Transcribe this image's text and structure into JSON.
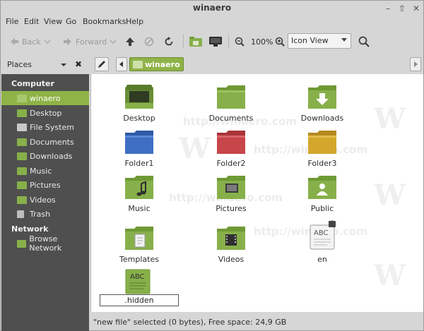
{
  "window": {
    "title": "winaero"
  },
  "menu": [
    "File",
    "Edit",
    "View",
    "Go",
    "Bookmarks",
    "Help"
  ],
  "toolbar": {
    "back": "Back",
    "forward": "Forward",
    "zoom": "100%",
    "view_mode": "Icon View"
  },
  "sidebar": {
    "header": "Places",
    "computer_heading": "Computer",
    "network_heading": "Network",
    "computer_items": [
      "winaero",
      "Desktop",
      "File System",
      "Documents",
      "Downloads",
      "Music",
      "Pictures",
      "Videos",
      "Trash"
    ],
    "network_items": [
      "Browse Network"
    ]
  },
  "location": {
    "current": "winaero"
  },
  "files": [
    {
      "name": "Desktop"
    },
    {
      "name": "Documents"
    },
    {
      "name": "Downloads"
    },
    {
      "name": "Folder1"
    },
    {
      "name": "Folder2"
    },
    {
      "name": "Folder3"
    },
    {
      "name": "Music"
    },
    {
      "name": "Pictures"
    },
    {
      "name": "Public"
    },
    {
      "name": "Templates"
    },
    {
      "name": "Videos"
    },
    {
      "name": "en"
    }
  ],
  "file_abc": "ABC",
  "rename_value": ".hidden",
  "watermark": "http://winaero.com",
  "watermark_logo": "W",
  "status": "\"new file\" selected (0 bytes), Free space: 24,9 GB",
  "colors": {
    "accent": "#8fb347",
    "folder_green": "#87b04a",
    "folder_blue": "#3f6fc4",
    "folder_red": "#c8454a",
    "folder_yellow": "#d4a72c"
  }
}
